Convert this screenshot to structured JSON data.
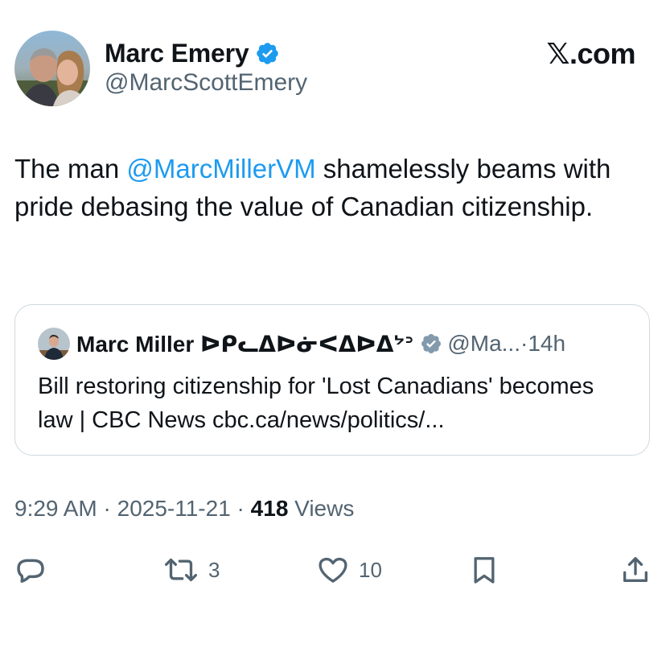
{
  "site": {
    "logo_text": "𝕏.com"
  },
  "author": {
    "display_name": "Marc Emery",
    "handle": "@MarcScottEmery",
    "verified": true
  },
  "tweet": {
    "text_before": "The man ",
    "mention": "@MarcMillerVM",
    "text_after": " shamelessly beams with pride debasing the value of Canadian citizenship."
  },
  "quote": {
    "display_name": "Marc Miller ᐅᑭᓚᐃᐅᓃᐸᐃᐅᐃᔾᐣ",
    "handle": "@Ma...",
    "separator": " · ",
    "age": "14h",
    "text": "Bill restoring citizenship for 'Lost Canadians' becomes law | CBC News cbc.ca/news/politics/..."
  },
  "meta": {
    "time": "9:29 AM",
    "dot1": " · ",
    "date": "2025-11-21",
    "dot2": " · ",
    "views_count": "418",
    "views_label": " Views"
  },
  "actions": {
    "reply_icon": "reply-icon",
    "retweet_icon": "retweet-icon",
    "retweet_count": "3",
    "like_icon": "heart-icon",
    "like_count": "10",
    "bookmark_icon": "bookmark-icon",
    "share_icon": "share-icon"
  },
  "colors": {
    "link": "#1d9bf0",
    "secondary_text": "#536471",
    "verified_badge": "#1d9bf0",
    "quote_verified_badge": "#829aab",
    "border": "#cfd9de"
  }
}
